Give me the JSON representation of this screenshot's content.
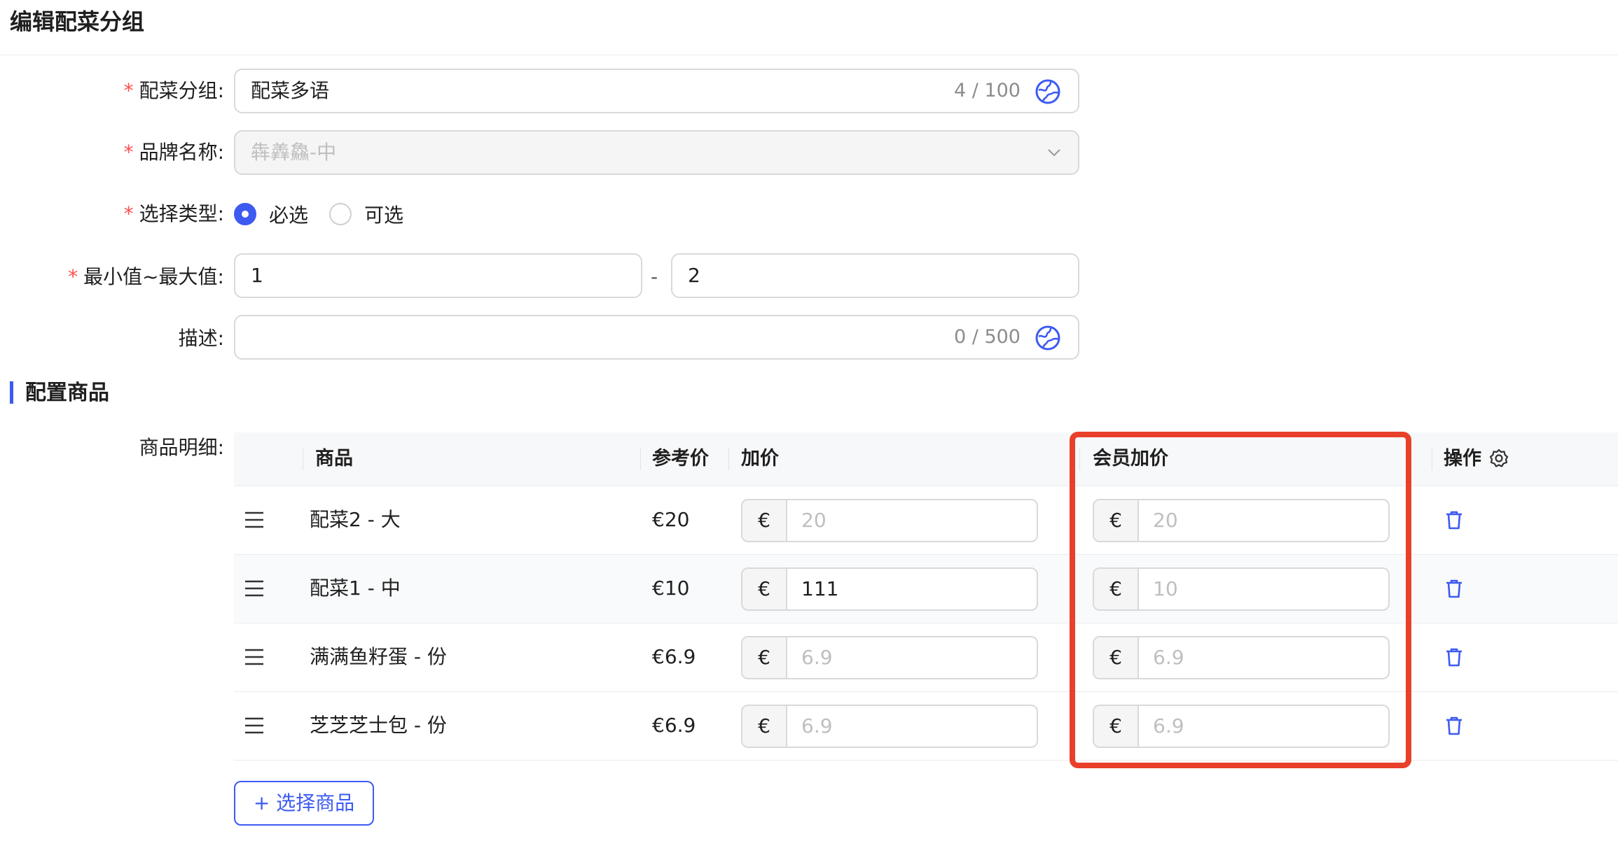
{
  "page": {
    "title": "编辑配菜分组"
  },
  "form": {
    "group": {
      "label": "配菜分组:",
      "value": "配菜多语",
      "count": "4 / 100",
      "icon": "globe-icon"
    },
    "brand": {
      "label": "品牌名称:",
      "value": "犇羴鱻-中"
    },
    "select_type": {
      "label": "选择类型:",
      "options": [
        "必选",
        "可选"
      ],
      "selected": "必选"
    },
    "range": {
      "label": "最小值~最大值:",
      "min": "1",
      "separator": "-",
      "max": "2"
    },
    "description": {
      "label": "描述:",
      "value": "",
      "count": "0 / 500",
      "icon": "globe-icon"
    }
  },
  "section": {
    "title": "配置商品"
  },
  "table": {
    "label": "商品明细:",
    "headers": {
      "product": "商品",
      "ref_price": "参考价",
      "add_price": "加价",
      "member_price": "会员加价",
      "actions": "操作"
    },
    "currency": "€",
    "rows": [
      {
        "product": "配菜2 - 大",
        "ref_price": "€20",
        "add_price": "20",
        "add_price_is_placeholder": true,
        "member_price": "20",
        "member_price_is_placeholder": true
      },
      {
        "product": "配菜1 - 中",
        "ref_price": "€10",
        "add_price": "111",
        "add_price_is_placeholder": false,
        "member_price": "10",
        "member_price_is_placeholder": true
      },
      {
        "product": "满满鱼籽蛋 - 份",
        "ref_price": "€6.9",
        "add_price": "6.9",
        "add_price_is_placeholder": true,
        "member_price": "6.9",
        "member_price_is_placeholder": true
      },
      {
        "product": "芝芝芝士包 - 份",
        "ref_price": "€6.9",
        "add_price": "6.9",
        "add_price_is_placeholder": true,
        "member_price": "6.9",
        "member_price_is_placeholder": true
      }
    ]
  },
  "add_button": {
    "label": "+ 选择商品"
  },
  "colors": {
    "primary": "#3d5af1",
    "required": "#ff4d4f",
    "highlight": "#e8402a"
  }
}
